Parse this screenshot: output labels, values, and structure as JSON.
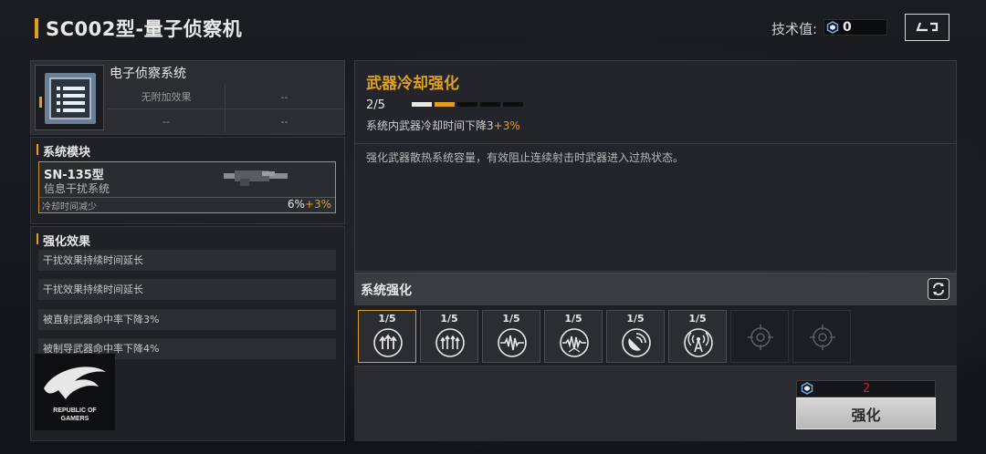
{
  "header": {
    "title": "SC002型-量子侦察机",
    "tech_label": "技术值:",
    "tech_value": "0"
  },
  "system": {
    "name": "电子侦察系统",
    "cells": [
      "无附加效果",
      "--",
      "--",
      "--"
    ]
  },
  "modules_section": {
    "title": "系统模块",
    "module": {
      "name": "SN-135型",
      "subtitle": "信息干扰系统",
      "stat_label": "冷却时间减少",
      "stat_base": "6%",
      "stat_bonus": "+3%"
    }
  },
  "effects_section": {
    "title": "强化效果",
    "items": [
      "干扰效果持续时间延长",
      "干扰效果持续时间延长",
      "被直射武器命中率下降3%",
      "被制导武器命中率下降4%"
    ]
  },
  "logo": {
    "text_line1": "REPUBLIC OF",
    "text_line2": "GAMERS"
  },
  "detail": {
    "title": "武器冷却强化",
    "level": "2/5",
    "level_current": 2,
    "level_max": 5,
    "effect_text": "系统内武器冷却时间下降3",
    "effect_bonus": "+3%",
    "description": "强化武器散热系统容量，有效阻止连续射击时武器进入过热状态。"
  },
  "enhance": {
    "title": "系统强化",
    "slots": [
      {
        "count": "1/5",
        "icon": "triple-arrow-up-icon",
        "selected": true,
        "locked": false
      },
      {
        "count": "1/5",
        "icon": "quad-arrow-up-icon",
        "selected": false,
        "locked": false
      },
      {
        "count": "1/5",
        "icon": "waveform-icon",
        "selected": false,
        "locked": false
      },
      {
        "count": "1/5",
        "icon": "waveform-pulse-icon",
        "selected": false,
        "locked": false
      },
      {
        "count": "1/5",
        "icon": "satellite-dish-icon",
        "selected": false,
        "locked": false
      },
      {
        "count": "1/5",
        "icon": "signal-tower-icon",
        "selected": false,
        "locked": false
      },
      {
        "count": "",
        "icon": "locked-target-icon",
        "selected": false,
        "locked": true
      },
      {
        "count": "",
        "icon": "locked-target-icon",
        "selected": false,
        "locked": true
      }
    ],
    "cost": "2",
    "upgrade_label": "强化"
  },
  "colors": {
    "accent": "#e0a020",
    "cost_red": "#d02020",
    "icon_blue": "#6a7f96"
  }
}
